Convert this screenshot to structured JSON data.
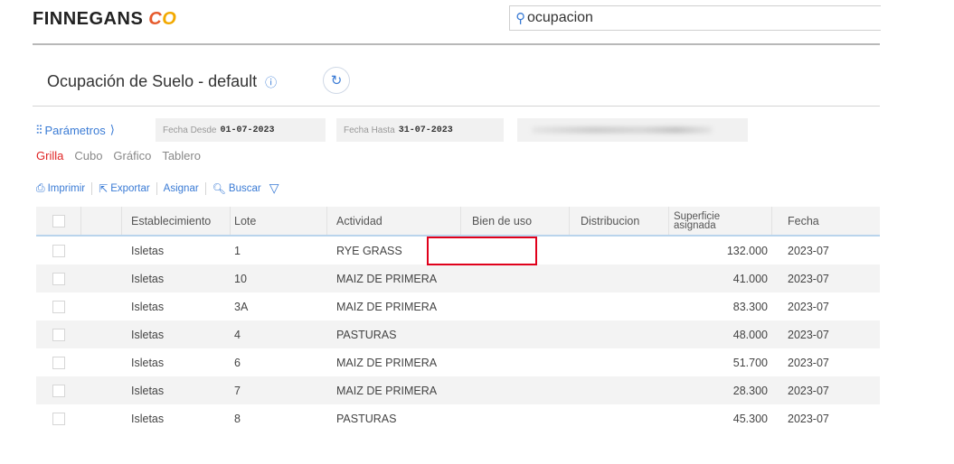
{
  "header": {
    "logo_text": "FINNEGANS",
    "logo_mark_c": "C",
    "logo_mark_o": "O",
    "search_value": "ocupacion"
  },
  "title": {
    "text": "Ocupación de Suelo - default",
    "info_icon": "info-icon",
    "refresh_icon": "refresh-icon"
  },
  "params": {
    "label": "Parámetros",
    "chevron": "⟩",
    "fecha_desde_label": "Fecha Desde",
    "fecha_desde_value": "01-07-2023",
    "fecha_hasta_label": "Fecha Hasta",
    "fecha_hasta_value": "31-07-2023"
  },
  "views": [
    "Grilla",
    "Cubo",
    "Gráfico",
    "Tablero"
  ],
  "toolbar": {
    "print_label": "Imprimir",
    "export_label": "Exportar",
    "assign_label": "Asignar",
    "search_label": "Buscar"
  },
  "table": {
    "columns": {
      "establecimiento": "Establecimiento",
      "lote": "Lote",
      "actividad": "Actividad",
      "bien_de_uso": "Bien de uso",
      "distribucion": "Distribucion",
      "superficie_line1": "Superficie",
      "superficie_line2": "asignada",
      "fecha": "Fecha"
    },
    "rows": [
      {
        "establecimiento": "Isletas",
        "lote": "1",
        "actividad": "RYE GRASS",
        "bien_de_uso": "",
        "distribucion": "",
        "superficie": "132.000",
        "fecha": "2023-07"
      },
      {
        "establecimiento": "Isletas",
        "lote": "10",
        "actividad": "MAIZ DE PRIMERA",
        "bien_de_uso": "",
        "distribucion": "",
        "superficie": "41.000",
        "fecha": "2023-07"
      },
      {
        "establecimiento": "Isletas",
        "lote": "3A",
        "actividad": "MAIZ DE PRIMERA",
        "bien_de_uso": "",
        "distribucion": "",
        "superficie": "83.300",
        "fecha": "2023-07"
      },
      {
        "establecimiento": "Isletas",
        "lote": "4",
        "actividad": "PASTURAS",
        "bien_de_uso": "",
        "distribucion": "",
        "superficie": "48.000",
        "fecha": "2023-07"
      },
      {
        "establecimiento": "Isletas",
        "lote": "6",
        "actividad": "MAIZ DE PRIMERA",
        "bien_de_uso": "",
        "distribucion": "",
        "superficie": "51.700",
        "fecha": "2023-07"
      },
      {
        "establecimiento": "Isletas",
        "lote": "7",
        "actividad": "MAIZ DE PRIMERA",
        "bien_de_uso": "",
        "distribucion": "",
        "superficie": "28.300",
        "fecha": "2023-07"
      },
      {
        "establecimiento": "Isletas",
        "lote": "8",
        "actividad": "PASTURAS",
        "bien_de_uso": "",
        "distribucion": "",
        "superficie": "45.300",
        "fecha": "2023-07"
      }
    ]
  },
  "colors": {
    "accent": "#3a7bd5",
    "active_tab": "#e02424",
    "highlight_box": "#e0001b"
  }
}
